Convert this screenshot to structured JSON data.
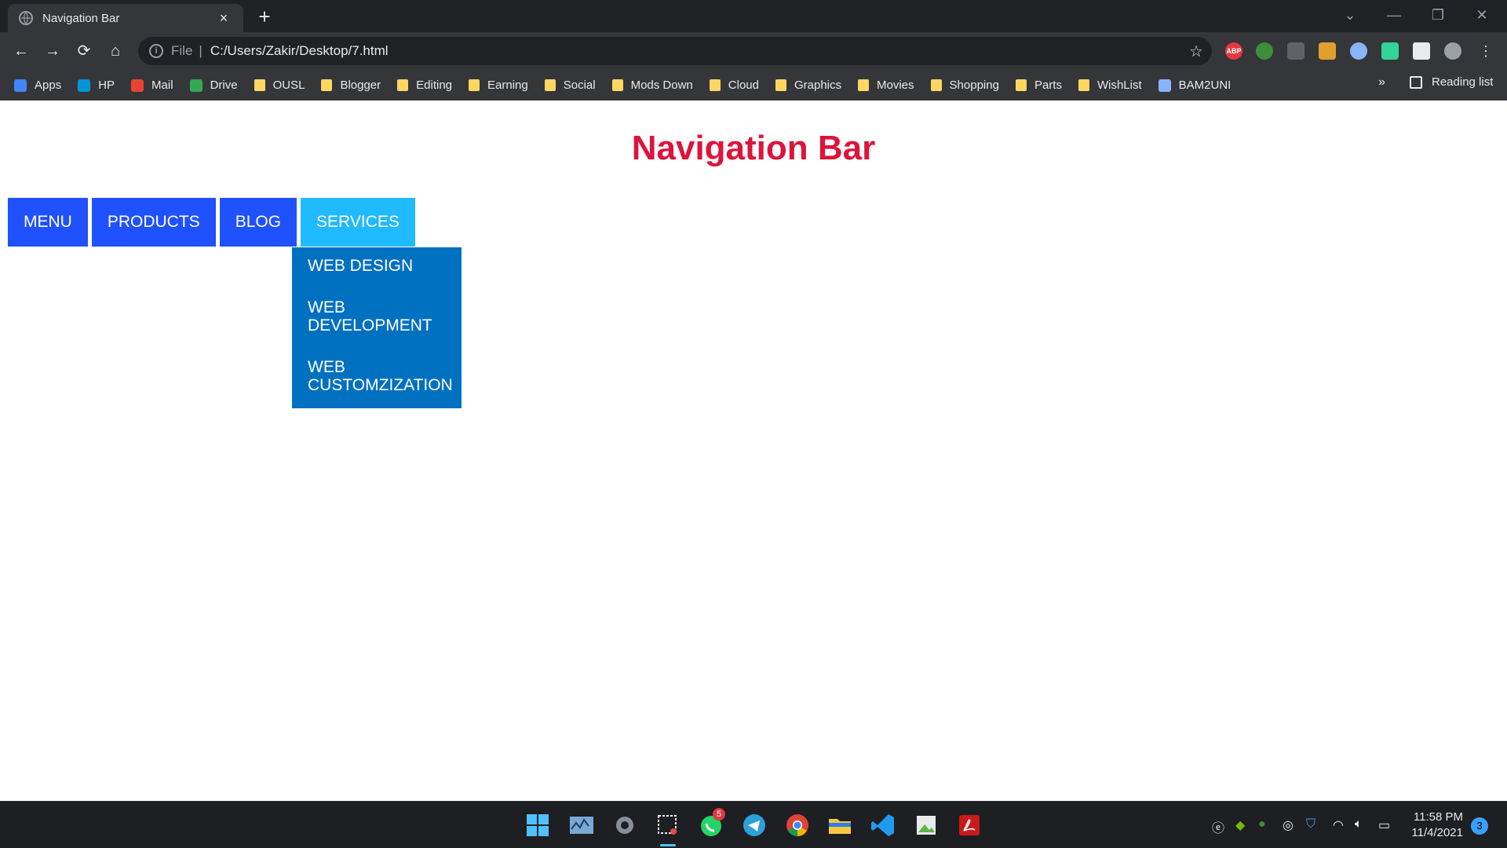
{
  "browser": {
    "tab_title": "Navigation Bar",
    "url_scheme": "File",
    "url_path": "C:/Users/Zakir/Desktop/7.html",
    "bookmarks": [
      "Apps",
      "HP",
      "Mail",
      "Drive",
      "OUSL",
      "Blogger",
      "Editing",
      "Earning",
      "Social",
      "Mods Down",
      "Cloud",
      "Graphics",
      "Movies",
      "Shopping",
      "Parts",
      "WishList",
      "BAM2UNI"
    ],
    "more_label": "»",
    "reading_list_label": "Reading list",
    "extension_badge": "ABP"
  },
  "page": {
    "heading": "Navigation Bar",
    "nav": [
      "MENU",
      "PRODUCTS",
      "BLOG",
      "SERVICES"
    ],
    "active_nav": "SERVICES",
    "dropdown": [
      "WEB DESIGN",
      "WEB DEVELOPMENT",
      "WEB CUSTOMZIZATION"
    ]
  },
  "colors": {
    "heading": "#dc143c",
    "nav_bg": "#1f51ff",
    "nav_active_bg": "#1fbaff",
    "dropdown_bg": "#0070c0"
  },
  "taskbar": {
    "whatsapp_badge": "5",
    "time": "11:58 PM",
    "date": "11/4/2021",
    "notification_count": "3"
  }
}
